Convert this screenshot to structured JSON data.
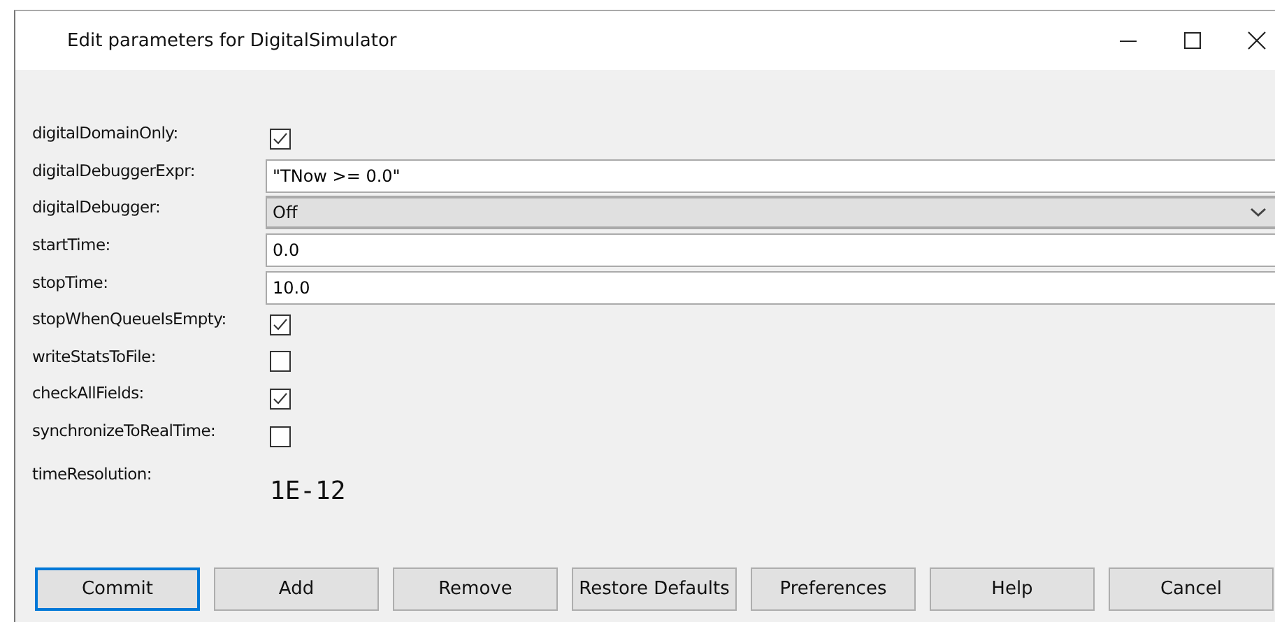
{
  "window": {
    "title": "Edit parameters for DigitalSimulator"
  },
  "parameters": [
    {
      "label": "digitalDomainOnly:",
      "kind": "checkbox",
      "checked": true
    },
    {
      "label": "digitalDebuggerExpr:",
      "kind": "text",
      "value": "\"TNow >= 0.0\""
    },
    {
      "label": "digitalDebugger:",
      "kind": "select",
      "value": "Off"
    },
    {
      "label": "startTime:",
      "kind": "text",
      "value": "0.0"
    },
    {
      "label": "stopTime:",
      "kind": "text",
      "value": "10.0"
    },
    {
      "label": "stopWhenQueueIsEmpty:",
      "kind": "checkbox",
      "checked": true
    },
    {
      "label": "writeStatsToFile:",
      "kind": "checkbox",
      "checked": false
    },
    {
      "label": "checkAllFields:",
      "kind": "checkbox",
      "checked": true
    },
    {
      "label": "synchronizeToRealTime:",
      "kind": "checkbox",
      "checked": false
    },
    {
      "label": "timeResolution:",
      "kind": "readonly",
      "value": "1E-12"
    }
  ],
  "buttons": [
    {
      "label": "Commit",
      "selected": true
    },
    {
      "label": "Add",
      "selected": false
    },
    {
      "label": "Remove",
      "selected": false
    },
    {
      "label": "Restore Defaults",
      "selected": false
    },
    {
      "label": "Preferences",
      "selected": false
    },
    {
      "label": "Help",
      "selected": false
    },
    {
      "label": "Cancel",
      "selected": false
    }
  ]
}
